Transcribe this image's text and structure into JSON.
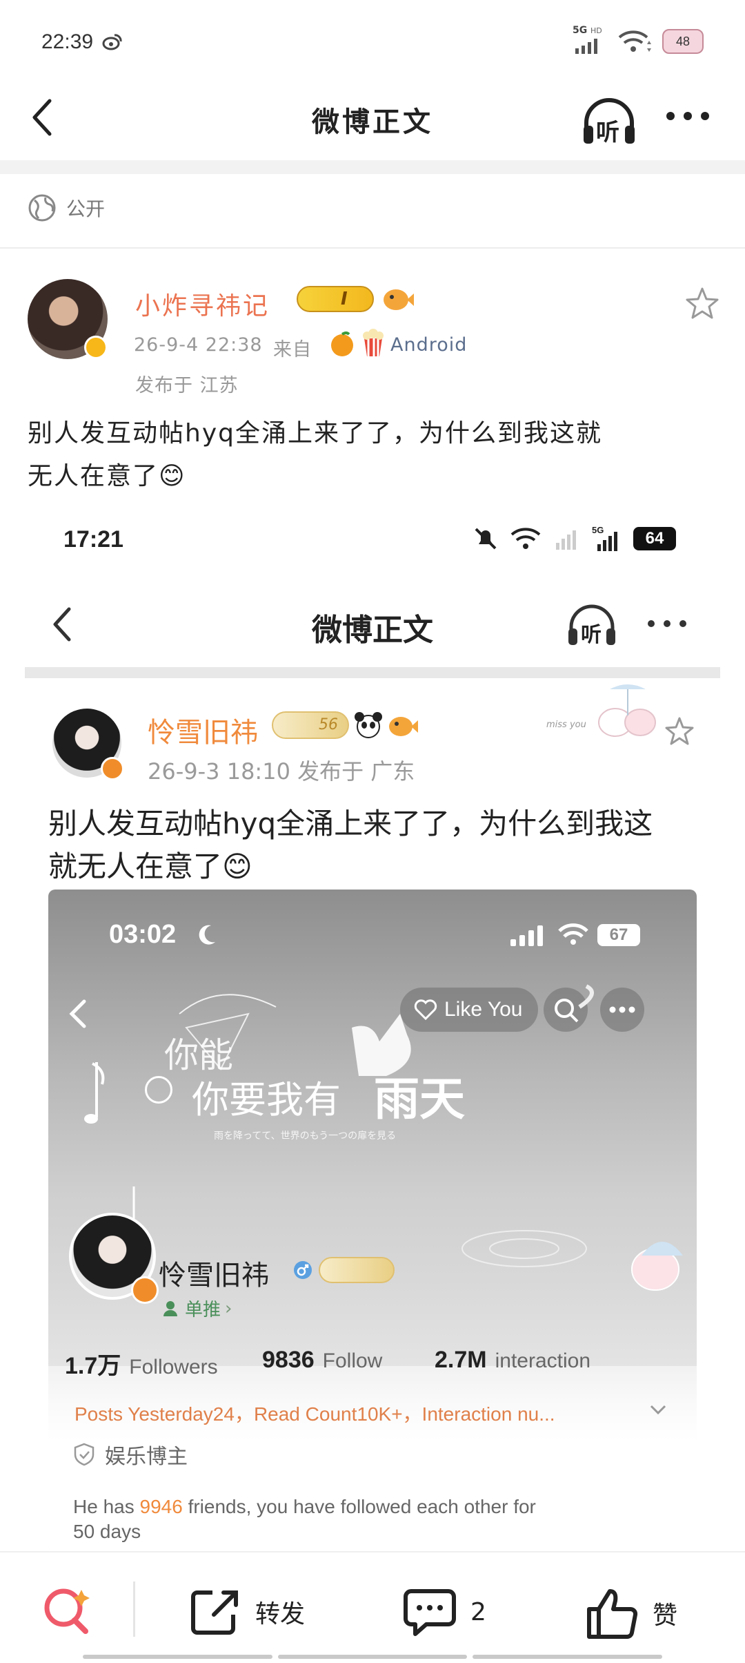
{
  "status_bar": {
    "time": "22:39",
    "network": "5G",
    "hd": "HD",
    "battery": "48"
  },
  "nav": {
    "title": "微博正文",
    "listen_label": "听"
  },
  "visibility": {
    "label": "公开"
  },
  "post": {
    "author": "小炸寻祎记",
    "date": "26-9-4 22:38",
    "source_prefix": "来自",
    "source": "Android",
    "location": "发布于 江苏",
    "text_line1": "别人发互动帖hyq全涌上来了了，为什么到我这就",
    "text_line2": "无人在意了😊"
  },
  "inner": {
    "status_time": "17:21",
    "status_battery": "64",
    "nav_title": "微博正文",
    "listen_label": "听",
    "author": "怜雪旧祎",
    "level_badge": "56",
    "date_loc": "26-9-3 18:10  发布于 广东",
    "sticker_text": "miss you",
    "text_line1": "别人发互动帖hyq全涌上来了了，为什么到我这",
    "text_line2": "就无人在意了😊",
    "card": {
      "time": "03:02",
      "battery": "67",
      "like_label": "Like You",
      "banner_small": "你能",
      "banner_big": "你要我有",
      "banner_big2": "雨天",
      "banner_caption": "雨を降ってて、世界のもう一つの扉を見る",
      "name": "怜雪旧祎",
      "tag": "单推",
      "followers_value": "1.7万",
      "followers_label": "Followers",
      "follow_value": "9836",
      "follow_label": "Follow",
      "interaction_value": "2.7M",
      "interaction_label": "interaction",
      "stats_line": "Posts Yesterday24，Read Count10K+，Interaction nu...",
      "category": "娱乐博主",
      "friends_prefix": "He has",
      "friends_count": "9946",
      "friends_suffix": "friends, you have followed each other for",
      "friends_days": "50 days"
    }
  },
  "bottom_bar": {
    "repost": "转发",
    "comment_count": "2",
    "like": "赞"
  },
  "colors": {
    "accent": "#eb7350",
    "badge": "#f7b719"
  }
}
